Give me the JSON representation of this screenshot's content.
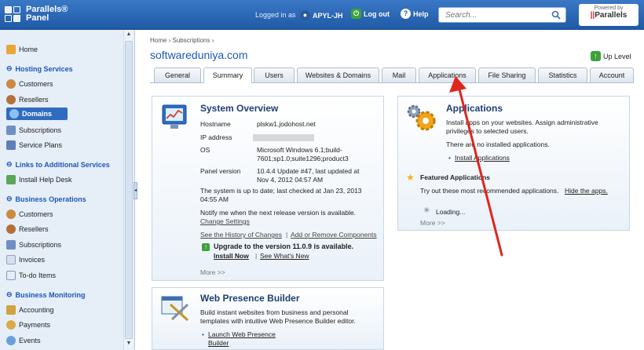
{
  "header": {
    "logo_line1": "Parallels®",
    "logo_line2": "Panel",
    "logged_in_as": "Logged in as",
    "user": "APYL-JH",
    "logout": "Log out",
    "help": "Help",
    "search_placeholder": "Search...",
    "powered_by": "Powered by",
    "powered_brand": "Parallels"
  },
  "sidebar": {
    "home": "Home",
    "hosting_services": "Hosting Services",
    "customers": "Customers",
    "resellers": "Resellers",
    "domains": "Domains",
    "subscriptions": "Subscriptions",
    "service_plans": "Service Plans",
    "links_additional": "Links to Additional Services",
    "install_help_desk": "Install Help Desk",
    "business_operations": "Business Operations",
    "bo_customers": "Customers",
    "bo_resellers": "Resellers",
    "bo_subscriptions": "Subscriptions",
    "invoices": "Invoices",
    "todo": "To-do Items",
    "business_monitoring": "Business Monitoring",
    "accounting": "Accounting",
    "payments": "Payments",
    "events": "Events"
  },
  "breadcrumb": {
    "home": "Home",
    "sep": "›",
    "subscriptions": "Subscriptions"
  },
  "site_title": "softwareduniya.com",
  "up_level": "Up Level",
  "tabs": [
    "General",
    "Summary",
    "Users",
    "Websites & Domains",
    "Mail",
    "Applications",
    "File Sharing",
    "Statistics",
    "Account"
  ],
  "system_overview": {
    "title": "System Overview",
    "hostname_label": "Hostname",
    "hostname": "plskw1.jodohost.net",
    "ip_label": "IP address",
    "os_label": "OS",
    "os_line1": "Microsoft Windows 6.1;build-",
    "os_line2": "7601;sp1.0;suite1296;product3",
    "panel_label": "Panel version",
    "panel_line1": "10.4.4 Update #47, last updated at",
    "panel_line2": "Nov 4, 2012 04:57 AM",
    "uptodate_line1": "The system is up to date; last checked at Jan 23, 2013",
    "uptodate_line2": "04:55 AM",
    "notify": "Notify me when the next release version is available.",
    "change_settings": "Change Settings",
    "history": "See the History of Changes",
    "pipe": "|",
    "add_remove": "Add or Remove Components",
    "upgrade": "Upgrade to the version 11.0.9 is available.",
    "install_now": "Install Now",
    "pipe2": "|",
    "whats_new": "See What's New",
    "more": "More >>"
  },
  "applications": {
    "title": "Applications",
    "desc_line1": "Install apps on your websites. Assign administrative",
    "desc_line2": "privileges to selected users.",
    "none": "There are no installed applications.",
    "install": "Install Applications",
    "featured": "Featured Applications",
    "try": "Try out these most recommended applications.",
    "hide": "Hide the apps.",
    "loading": "Loading...",
    "more": "More >>"
  },
  "wpb": {
    "title": "Web Presence Builder",
    "desc_line1": "Build instant websites from business and personal",
    "desc_line2": "templates with intuitive Web Presence Builder editor.",
    "launch_line1": "Launch Web Presence",
    "launch_line2": "Builder"
  }
}
